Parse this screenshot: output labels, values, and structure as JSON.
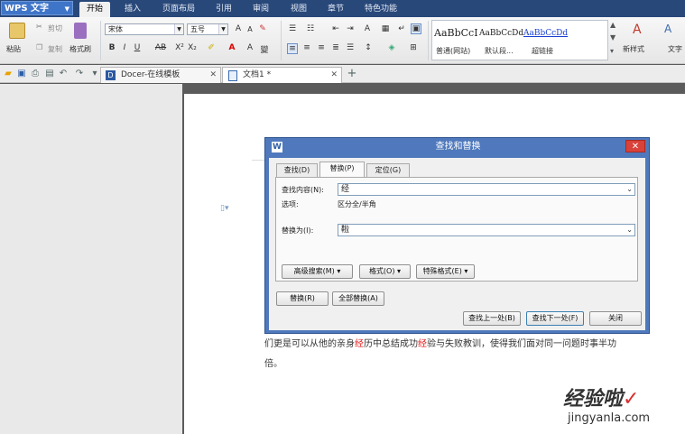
{
  "app": {
    "name": "WPS 文字"
  },
  "menu": [
    "开始",
    "插入",
    "页面布局",
    "引用",
    "审阅",
    "视图",
    "章节",
    "特色功能"
  ],
  "ribbon": {
    "paste": "粘贴",
    "cut": "剪切",
    "copy": "复制",
    "format_painter": "格式刷",
    "font_name": "宋体",
    "font_size": "五号",
    "styles": [
      {
        "sample": "AaBbCcI",
        "name": "普通(网站)"
      },
      {
        "sample": "AaBbCcDd",
        "name": "默认段..."
      },
      {
        "sample": "AaBbCcDd",
        "name": "超链接"
      }
    ],
    "new_style": "新样式",
    "text_tool": "文字"
  },
  "tabs": [
    {
      "label": "Docer-在线模板"
    },
    {
      "label": "文档1 *"
    }
  ],
  "document": {
    "line1_a": "们更是可以从他的亲身",
    "line1_hl1": "经",
    "line1_b": "历中总结成功",
    "line1_hl2": "经",
    "line1_c": "验与失败教训，使得我们面对同一问题时事半功",
    "line2": "倍。"
  },
  "dialog": {
    "title": "查找和替换",
    "tabs": [
      "查找(D)",
      "替换(P)",
      "定位(G)"
    ],
    "find_label": "查找内容(N):",
    "find_value": "经",
    "options_label": "选项:",
    "options_value": "区分全/半角",
    "replace_label": "替换为(I):",
    "replace_value": "鞡",
    "advanced_search": "高级搜索(M)",
    "format": "格式(O)",
    "special_format": "特殊格式(E)",
    "replace": "替换(R)",
    "replace_all": "全部替换(A)",
    "find_previous": "查找上一处(B)",
    "find_next": "查找下一处(F)",
    "close": "关闭"
  },
  "watermark": {
    "text": "经验啦",
    "url": "jingyanla.com",
    "check": "✓"
  }
}
